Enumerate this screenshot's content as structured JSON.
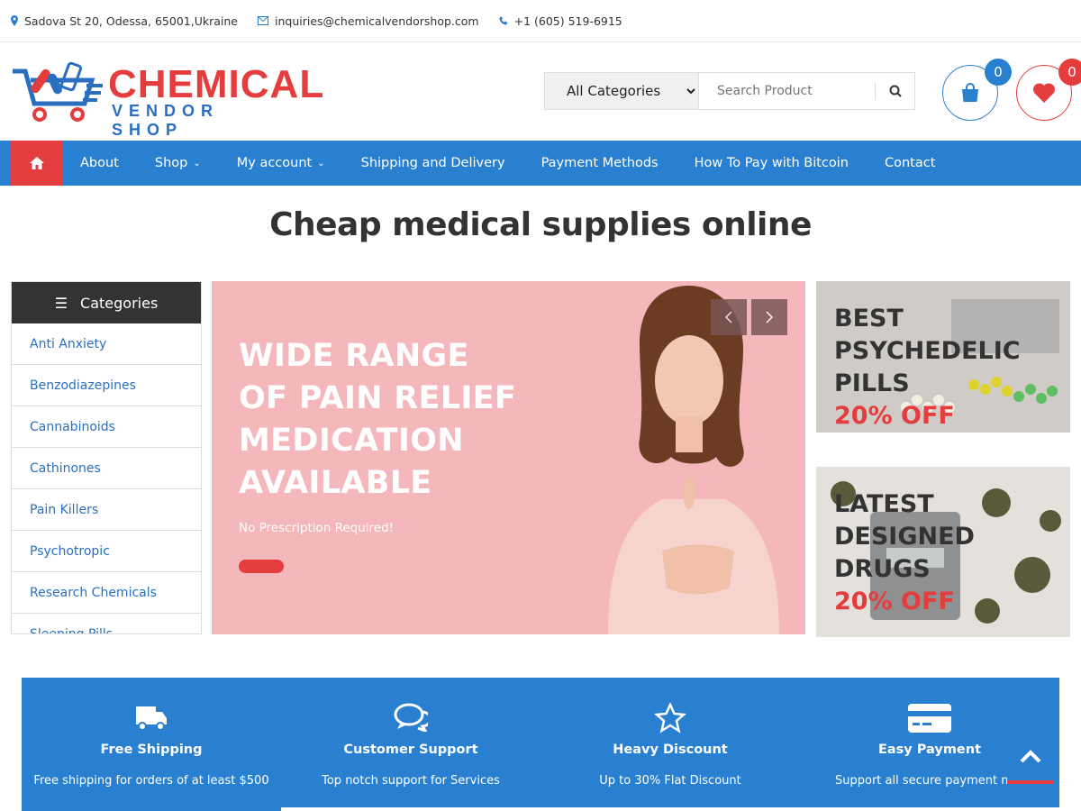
{
  "topbar": {
    "address": "Sadova St 20, Odessa, 65001,Ukraine",
    "email": "inquiries@chemicalvendorshop.com",
    "phone": "+1 (605) 519-6915"
  },
  "logo": {
    "line1": "CHEMICAL",
    "line2": "VENDOR SHOP"
  },
  "search": {
    "category": "All Categories",
    "placeholder": "Search Product"
  },
  "cart": {
    "count": "0"
  },
  "wishlist": {
    "count": "0"
  },
  "nav": {
    "items": [
      {
        "label": "About"
      },
      {
        "label": "Shop"
      },
      {
        "label": "My account"
      },
      {
        "label": "Shipping and Delivery"
      },
      {
        "label": "Payment Methods"
      },
      {
        "label": "How To Pay with Bitcoin"
      },
      {
        "label": "Contact"
      }
    ]
  },
  "page_title": "Cheap medical supplies online",
  "categories": {
    "title": "Categories",
    "items": [
      "Anti Anxiety",
      "Benzodiazepines",
      "Cannabinoids",
      "Cathinones",
      "Pain Killers",
      "Psychotropic",
      "Research Chemicals",
      "Sleeping Pills"
    ]
  },
  "slider": {
    "title": "WIDE RANGE OF PAIN RELIEF MEDICATION AVAILABLE",
    "subtitle": "No Prescription Required!"
  },
  "promos": [
    {
      "title": "BEST PSYCHEDELIC PILLS",
      "offer": "20% OFF"
    },
    {
      "title": "LATEST DESIGNED DRUGS",
      "offer": "20% OFF"
    }
  ],
  "features": [
    {
      "title": "Free Shipping",
      "desc": "Free shipping for orders of at least $500",
      "icon": "truck-icon"
    },
    {
      "title": "Customer Support",
      "desc": "Top notch support for Services",
      "icon": "chat-icon"
    },
    {
      "title": "Heavy Discount",
      "desc": "Up to 30% Flat Discount",
      "icon": "star-icon"
    },
    {
      "title": "Easy Payment",
      "desc": "Support all secure payment met",
      "icon": "credit-card-icon"
    }
  ],
  "colors": {
    "blue": "#2a80d0",
    "red": "#e53d3d",
    "dark": "#333333"
  }
}
